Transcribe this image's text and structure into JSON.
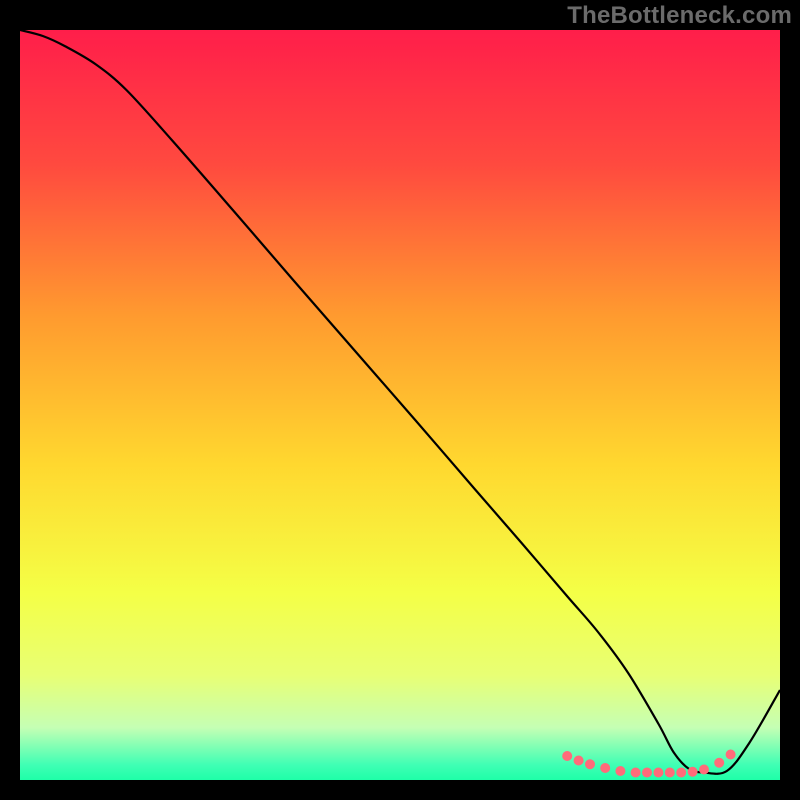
{
  "watermark": "TheBottleneck.com",
  "chart_data": {
    "type": "line",
    "title": "",
    "xlabel": "",
    "ylabel": "",
    "xlim": [
      0,
      100
    ],
    "ylim": [
      0,
      100
    ],
    "grid": false,
    "background_gradient_stops": [
      {
        "pos": 0.0,
        "color": "#ff1e4a"
      },
      {
        "pos": 0.18,
        "color": "#ff4a3f"
      },
      {
        "pos": 0.38,
        "color": "#ff9a2f"
      },
      {
        "pos": 0.58,
        "color": "#ffd82f"
      },
      {
        "pos": 0.75,
        "color": "#f4ff46"
      },
      {
        "pos": 0.86,
        "color": "#e8ff74"
      },
      {
        "pos": 0.93,
        "color": "#c5ffb4"
      },
      {
        "pos": 0.98,
        "color": "#3fffb4"
      },
      {
        "pos": 1.0,
        "color": "#1effa8"
      }
    ],
    "series": [
      {
        "name": "curve",
        "stroke": "#000000",
        "x": [
          0,
          3,
          6,
          10,
          14,
          20,
          28,
          36,
          44,
          52,
          60,
          66,
          72,
          76,
          80,
          84,
          86,
          88,
          90,
          93,
          96,
          100
        ],
        "y": [
          100,
          99.2,
          97.8,
          95.4,
          92.0,
          85.3,
          76.0,
          66.6,
          57.3,
          48.0,
          38.6,
          31.6,
          24.5,
          19.8,
          14.3,
          7.5,
          3.7,
          1.5,
          1.0,
          1.2,
          5.0,
          12.0
        ]
      }
    ],
    "markers": {
      "name": "minimum-dots",
      "color": "#ff6b7a",
      "radius": 5,
      "points": [
        {
          "x": 72,
          "y": 3.2
        },
        {
          "x": 73.5,
          "y": 2.6
        },
        {
          "x": 75,
          "y": 2.1
        },
        {
          "x": 77,
          "y": 1.6
        },
        {
          "x": 79,
          "y": 1.2
        },
        {
          "x": 81,
          "y": 1.0
        },
        {
          "x": 82.5,
          "y": 1.0
        },
        {
          "x": 84,
          "y": 1.0
        },
        {
          "x": 85.5,
          "y": 1.0
        },
        {
          "x": 87,
          "y": 1.0
        },
        {
          "x": 88.5,
          "y": 1.1
        },
        {
          "x": 90,
          "y": 1.4
        },
        {
          "x": 92,
          "y": 2.3
        },
        {
          "x": 93.5,
          "y": 3.4
        }
      ]
    }
  }
}
